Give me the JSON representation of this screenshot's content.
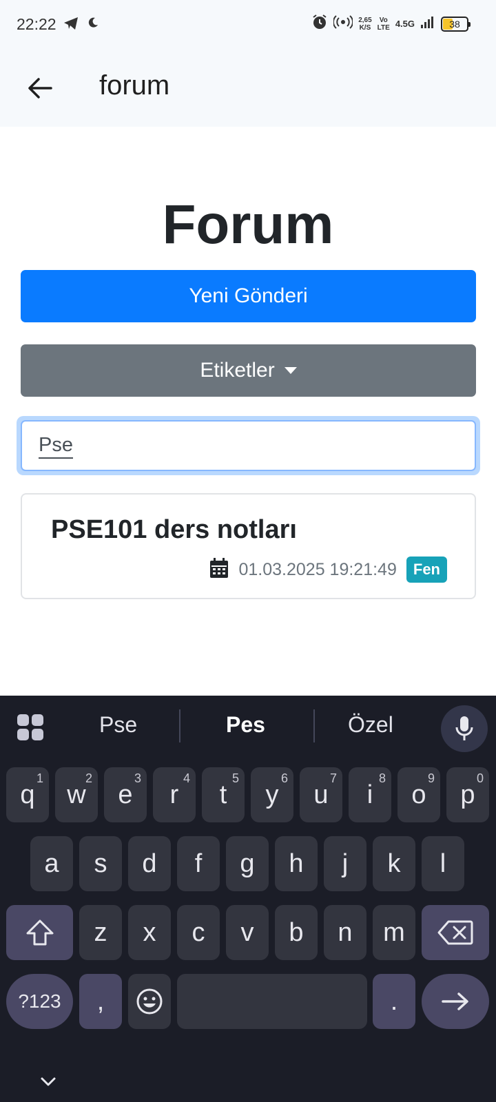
{
  "status_bar": {
    "time": "22:22",
    "speed_value": "2,65",
    "speed_unit": "K/S",
    "volte_top": "Vo",
    "volte_bottom": "LTE",
    "network": "4.5G",
    "battery": "38",
    "icons": [
      "telegram-icon",
      "moon-icon",
      "alarm-icon",
      "hotspot-icon",
      "signal-icon",
      "battery-icon"
    ]
  },
  "app_bar": {
    "title": "forum",
    "back_icon": "arrow-left-icon"
  },
  "page": {
    "title": "Forum",
    "new_post_label": "Yeni Gönderi",
    "tags_label": "Etiketler"
  },
  "search": {
    "value": "Pse"
  },
  "posts": [
    {
      "title": "PSE101 ders notları",
      "date": "01.03.2025 19:21:49",
      "tag": "Fen"
    }
  ],
  "colors": {
    "primary": "#0a7bff",
    "secondary": "#6c757d",
    "badge": "#17a2b8",
    "keyboard_bg": "#1b1d27"
  },
  "keyboard": {
    "suggestions": [
      "Pse",
      "Pes",
      "Özel"
    ],
    "row1": [
      "q",
      "w",
      "e",
      "r",
      "t",
      "y",
      "u",
      "i",
      "o",
      "p"
    ],
    "row1_numbers": [
      "1",
      "2",
      "3",
      "4",
      "5",
      "6",
      "7",
      "8",
      "9",
      "0"
    ],
    "row2": [
      "a",
      "s",
      "d",
      "f",
      "g",
      "h",
      "j",
      "k",
      "l"
    ],
    "row3": [
      "z",
      "x",
      "c",
      "v",
      "b",
      "n",
      "m"
    ],
    "symbols_key": "?123",
    "comma_key": ",",
    "period_key": "."
  }
}
